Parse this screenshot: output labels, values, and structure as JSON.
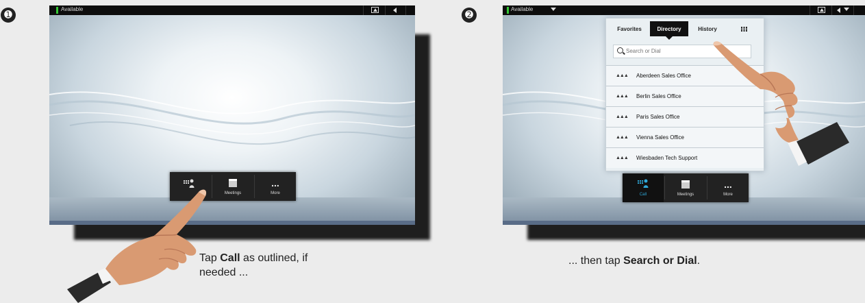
{
  "steps": [
    "➊",
    "➋"
  ],
  "colors": {
    "accent": "#2fa8d8",
    "available": "#35c935",
    "background": "#ececec"
  },
  "panel1": {
    "status": "Available",
    "dock": [
      {
        "icon": "call-icon",
        "label": ""
      },
      {
        "icon": "calendar-icon",
        "label": "Meetings"
      },
      {
        "icon": "more-icon",
        "label": "More",
        "glyph": "..."
      }
    ]
  },
  "panel2": {
    "status": "Available",
    "tabs": [
      {
        "label": "Favorites",
        "active": false
      },
      {
        "label": "Directory",
        "active": true
      },
      {
        "label": "History",
        "active": false
      },
      {
        "label": "",
        "icon": "keypad-icon",
        "active": false
      }
    ],
    "search_placeholder": "Search or Dial",
    "entries": [
      "Aberdeen Sales Office",
      "Berlin Sales Office",
      "Paris Sales Office",
      "Vienna Sales Office",
      "Wiesbaden Tech Support"
    ],
    "dock": [
      {
        "icon": "call-icon",
        "label": "Call",
        "selected": true
      },
      {
        "icon": "calendar-icon",
        "label": "Meetings"
      },
      {
        "icon": "more-icon",
        "label": "More",
        "glyph": "..."
      }
    ]
  },
  "captions": {
    "step1": {
      "pre": "Tap ",
      "bold": "Call",
      "post": " as outlined, if",
      "line2": "needed ..."
    },
    "step2": {
      "pre": "... then tap ",
      "bold": "Search or Dial",
      "post": "."
    }
  }
}
